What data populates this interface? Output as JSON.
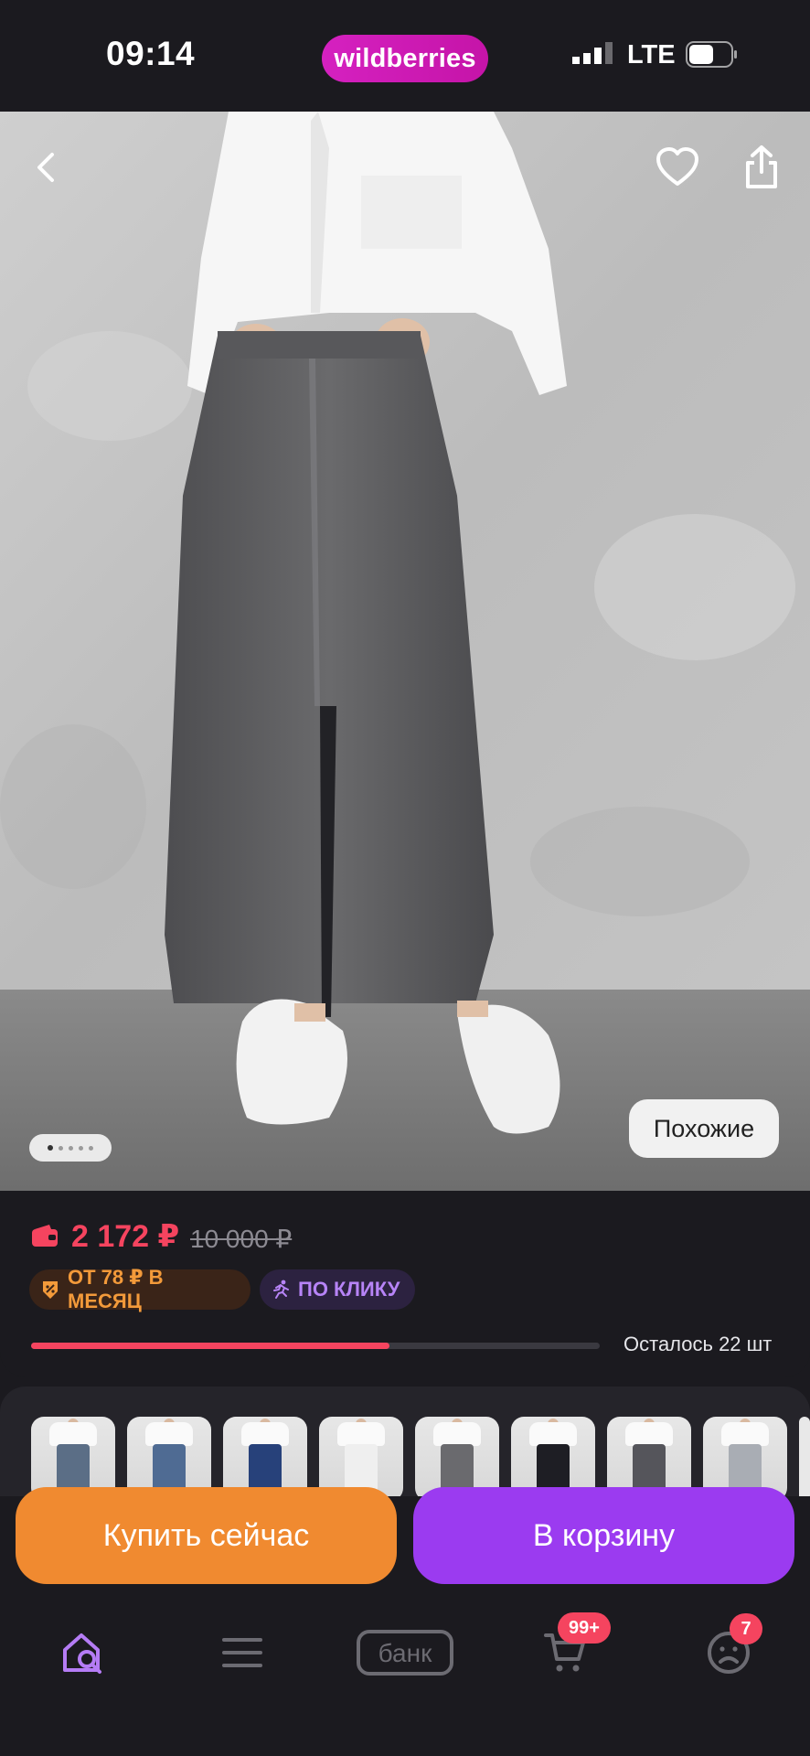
{
  "status_bar": {
    "time": "09:14",
    "brand": "wildberries",
    "network": "LTE"
  },
  "product": {
    "price": "2 172 ₽",
    "old_price": "10 000 ₽",
    "installment_badge": "ОТ 78 ₽ В МЕСЯЦ",
    "click_badge": "ПО КЛИКУ",
    "stock_text": "Осталось 22 шт",
    "stock_progress": 0.63,
    "similar_label": "Похожие",
    "image_count": 5,
    "image_index": 1
  },
  "thumbnails": [
    {
      "name": "thumb-blue-jeans",
      "skirt_color": "#5b6e86"
    },
    {
      "name": "thumb-light-blue-skirt",
      "skirt_color": "#4f6b93"
    },
    {
      "name": "thumb-navy-button-skirt",
      "skirt_color": "#27417a"
    },
    {
      "name": "thumb-white-shirt",
      "skirt_color": "#efefef"
    },
    {
      "name": "thumb-grey-skirt",
      "skirt_color": "#6a6a6e"
    },
    {
      "name": "thumb-black-skirt",
      "skirt_color": "#1e1e24"
    },
    {
      "name": "thumb-grey-button-skirt",
      "skirt_color": "#55555b"
    },
    {
      "name": "thumb-light-grey-skirt",
      "skirt_color": "#a9adb4"
    }
  ],
  "actions": {
    "buy_now": "Купить сейчас",
    "add_to_cart": "В корзину"
  },
  "tabbar": {
    "bank_label": "банк",
    "cart_count": "99+",
    "profile_count": "7",
    "active_color": "#b57cf5",
    "inactive_color": "#6c6b72"
  },
  "colors": {
    "accent_price": "#f5445f",
    "buy_now": "#f08a30",
    "add_to_cart": "#9b3bf0",
    "brand": "#cb11ab"
  }
}
